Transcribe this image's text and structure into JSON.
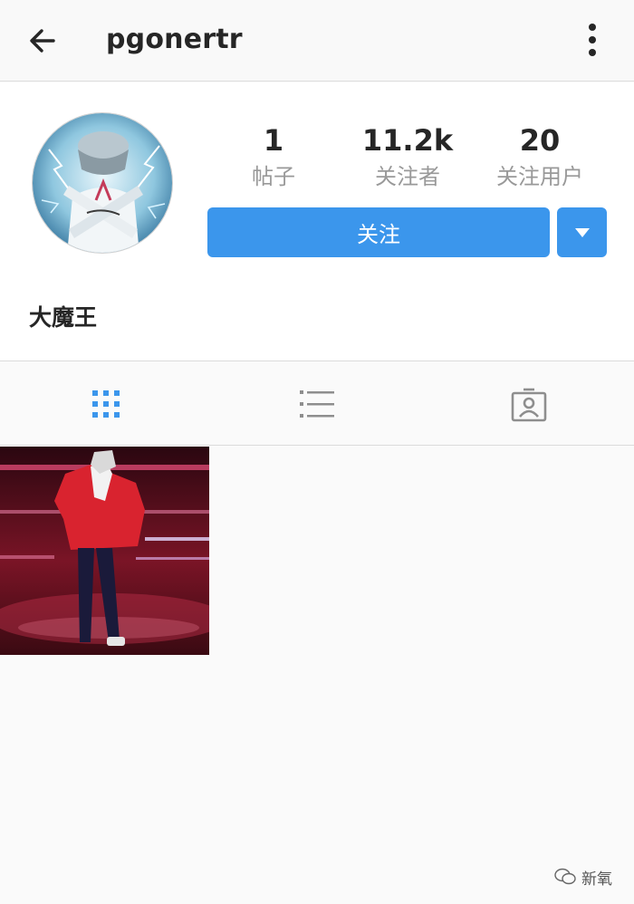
{
  "header": {
    "username": "pgonertr",
    "back_icon": "arrow-left-icon",
    "more_icon": "more-vertical-icon"
  },
  "profile": {
    "stats": [
      {
        "value": "1",
        "label": "帖子"
      },
      {
        "value": "11.2k",
        "label": "关注者"
      },
      {
        "value": "20",
        "label": "关注用户"
      }
    ],
    "follow_label": "关注",
    "dropdown_icon": "caret-down-icon",
    "display_name": "大魔王"
  },
  "tabs": [
    {
      "icon": "grid-icon",
      "active": true
    },
    {
      "icon": "list-icon",
      "active": false
    },
    {
      "icon": "tagged-person-icon",
      "active": false
    }
  ],
  "posts_count": 1,
  "watermark": {
    "text": "新氧"
  },
  "colors": {
    "accent": "#3b96ec",
    "text": "#262626",
    "muted": "#999999",
    "divider": "#dbdbdb"
  }
}
